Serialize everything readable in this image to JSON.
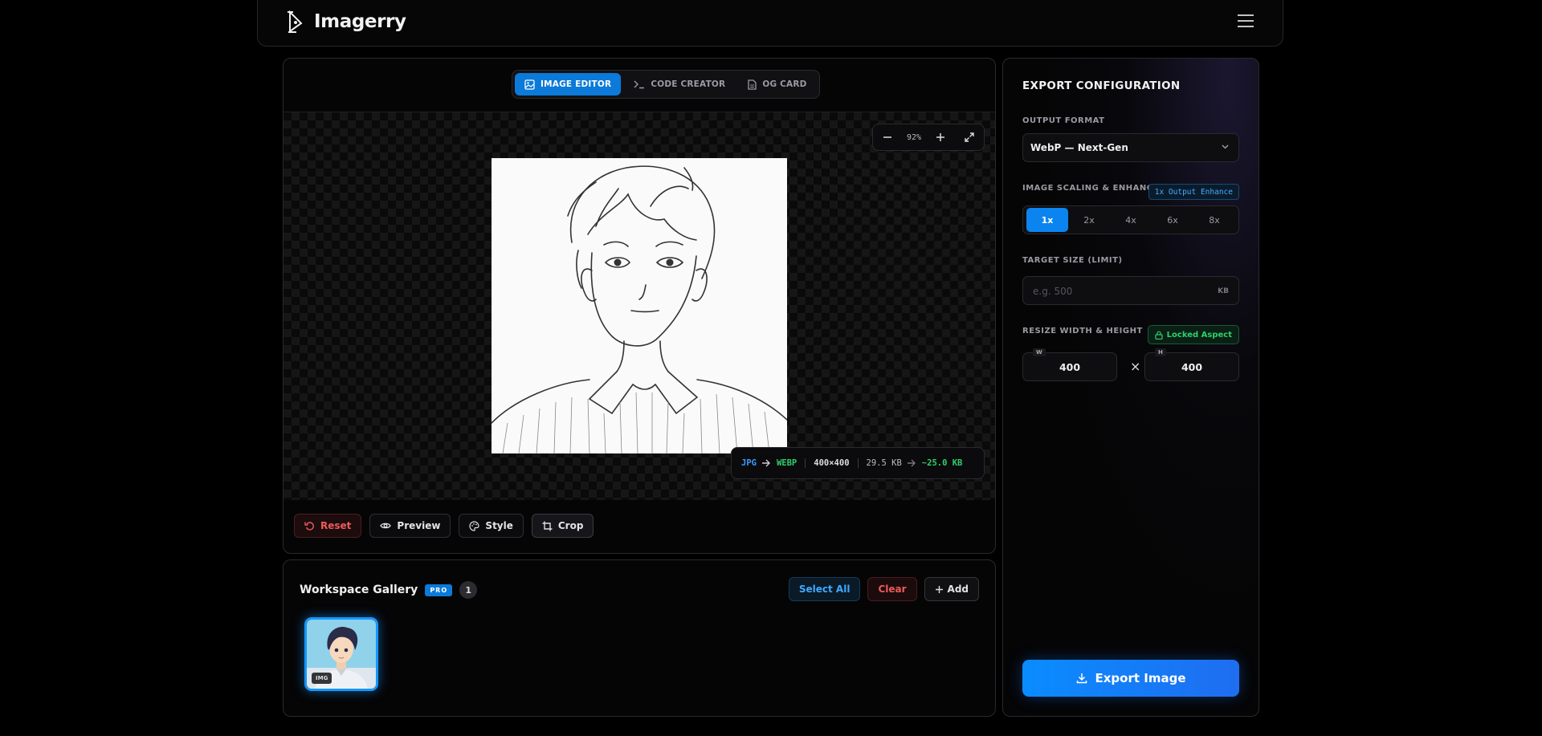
{
  "app": {
    "name": "Imagerry"
  },
  "editor": {
    "tabs": [
      {
        "label": "IMAGE EDITOR",
        "active": true
      },
      {
        "label": "CODE CREATOR",
        "active": false
      },
      {
        "label": "OG CARD",
        "active": false
      }
    ],
    "zoom": "92%",
    "info": {
      "from_format": "JPG",
      "to_format": "WEBP",
      "dimensions": "400×400",
      "original_size": "29.5 KB",
      "new_size": "~25.0 KB"
    },
    "toolbar": {
      "reset": "Reset",
      "preview": "Preview",
      "style": "Style",
      "crop": "Crop"
    }
  },
  "gallery": {
    "title": "Workspace Gallery",
    "badge": "PRO",
    "count": "1",
    "select_all": "Select All",
    "clear": "Clear",
    "add": "Add",
    "items": [
      {
        "badge": "IMG",
        "selected": true
      }
    ]
  },
  "export": {
    "title": "EXPORT CONFIGURATION",
    "output_format_label": "OUTPUT FORMAT",
    "output_format_value": "WebP — Next-Gen",
    "scaling_label": "IMAGE SCALING & ENHANCE",
    "scaling_badge": "1x Output Enhance",
    "scales": [
      "1x",
      "2x",
      "4x",
      "6x",
      "8x"
    ],
    "selected_scale": "1x",
    "target_size_label": "TARGET SIZE (LIMIT)",
    "target_size_placeholder": "e.g. 500",
    "target_size_unit": "KB",
    "resize_label": "RESIZE WIDTH & HEIGHT",
    "locked_aspect": "Locked Aspect",
    "width_tag": "W",
    "height_tag": "H",
    "width": "400",
    "height": "400",
    "times": "×",
    "export_button": "Export Image"
  },
  "colors": {
    "accent": "#0b84f0",
    "success": "#2fcf6b",
    "danger": "#ef5a5a",
    "background": "#000000"
  },
  "icons": [
    "logo-icon",
    "menu-icon",
    "image-icon",
    "terminal-icon",
    "document-icon",
    "zoom-out-icon",
    "zoom-in-icon",
    "fullscreen-icon",
    "arrow-right-icon",
    "undo-icon",
    "eye-icon",
    "palette-icon",
    "crop-icon",
    "plus-icon",
    "chevron-down-icon",
    "lock-icon",
    "download-icon"
  ]
}
